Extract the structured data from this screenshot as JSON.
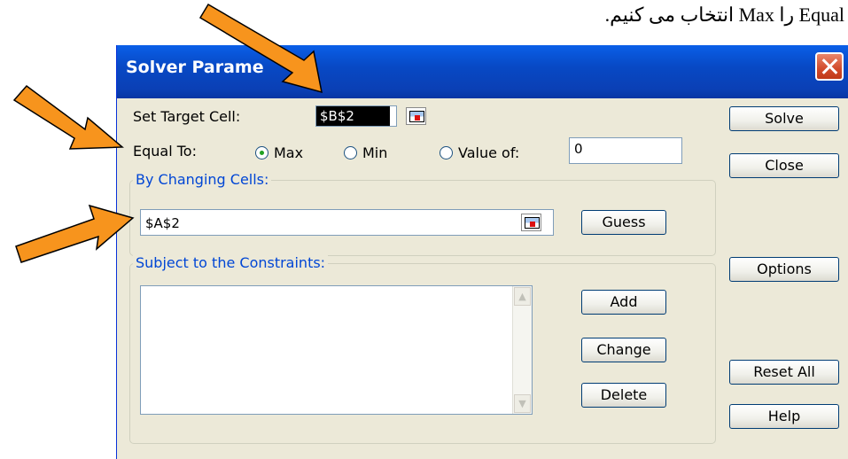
{
  "caption": "Equal را Max انتخاب می کنیم.",
  "dialog": {
    "title": "Solver Parame",
    "set_target_label": "Set Target Cell:",
    "set_target_value": "$B$2",
    "equal_to_label": "Equal To:",
    "radio_max": "Max",
    "radio_min": "Min",
    "radio_value_of": "Value of:",
    "value_of_value": "0",
    "selected_option": "Max",
    "changing_cells_label": "By Changing Cells:",
    "changing_cells_value": "$A$2",
    "constraints_label": "Subject to the Constraints:",
    "buttons": {
      "solve": "Solve",
      "close": "Close",
      "guess": "Guess",
      "options": "Options",
      "add": "Add",
      "change": "Change",
      "delete": "Delete",
      "reset_all": "Reset All",
      "help": "Help"
    }
  },
  "colors": {
    "arrow_fill": "#F7941D",
    "titlebar": "#0A53D6",
    "dialog_bg": "#ECE9D8"
  }
}
